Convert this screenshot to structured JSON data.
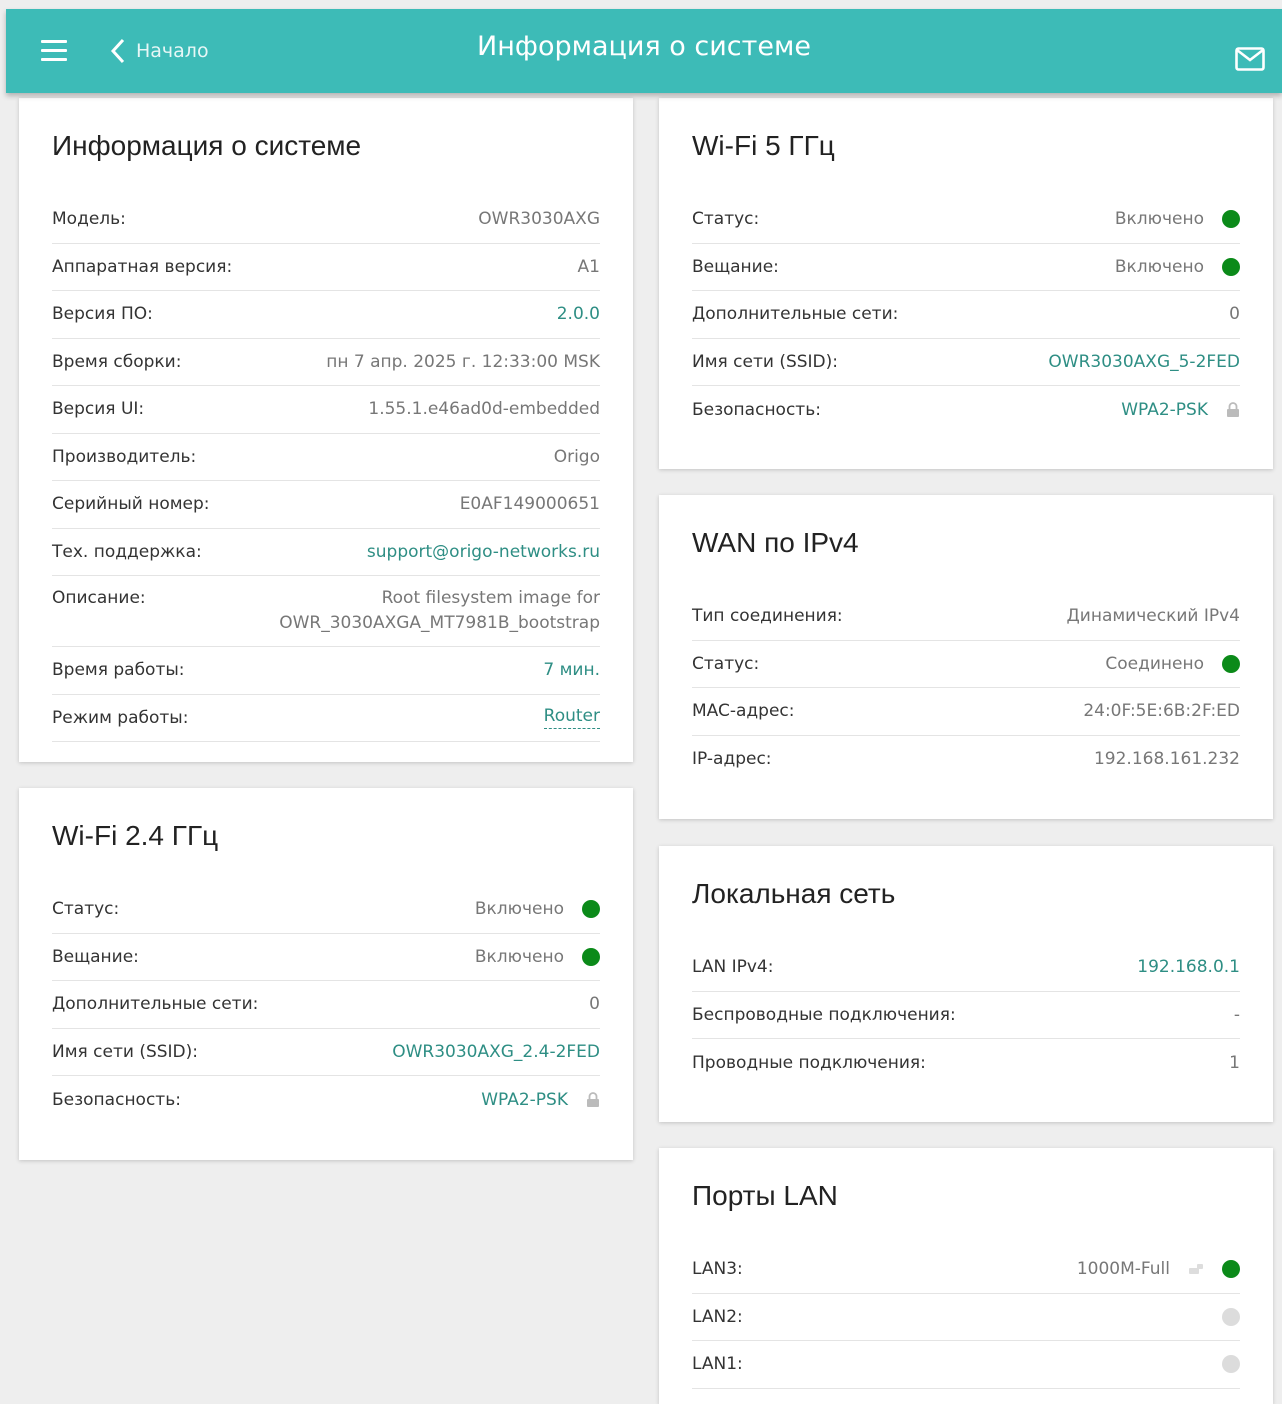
{
  "header": {
    "back_label": "Начало",
    "title": "Информация о системе"
  },
  "system": {
    "title": "Информация о системе",
    "rows": [
      {
        "label": "Модель:",
        "value": "OWR3030AXG"
      },
      {
        "label": "Аппаратная версия:",
        "value": "A1"
      },
      {
        "label": "Версия ПО:",
        "value": "2.0.0"
      },
      {
        "label": "Время сборки:",
        "value": "пн 7 апр. 2025 г. 12:33:00 MSK"
      },
      {
        "label": "Версия UI:",
        "value": "1.55.1.e46ad0d-embedded"
      },
      {
        "label": "Производитель:",
        "value": "Origo"
      },
      {
        "label": "Серийный номер:",
        "value": "E0AF149000651"
      },
      {
        "label": "Тех. поддержка:",
        "value": "support@origo-networks.ru"
      },
      {
        "label": "Описание:",
        "value_line1": "Root filesystem image for",
        "value_line2": "OWR_3030AXGA_MT7981B_bootstrap"
      },
      {
        "label": "Время работы:",
        "value": "7 мин."
      },
      {
        "label": "Режим работы:",
        "value": "Router"
      }
    ]
  },
  "wifi24": {
    "title": "Wi-Fi 2.4 ГГц",
    "rows": [
      {
        "label": "Статус:",
        "value": "Включено",
        "status": "green"
      },
      {
        "label": "Вещание:",
        "value": "Включено",
        "status": "green"
      },
      {
        "label": "Дополнительные сети:",
        "value": "0"
      },
      {
        "label": "Имя сети (SSID):",
        "value": "OWR3030AXG_2.4-2FED"
      },
      {
        "label": "Безопасность:",
        "value": "WPA2-PSK",
        "icon": "lock-icon"
      }
    ]
  },
  "wifi5": {
    "title": "Wi-Fi 5 ГГц",
    "rows": [
      {
        "label": "Статус:",
        "value": "Включено",
        "status": "green"
      },
      {
        "label": "Вещание:",
        "value": "Включено",
        "status": "green"
      },
      {
        "label": "Дополнительные сети:",
        "value": "0"
      },
      {
        "label": "Имя сети (SSID):",
        "value": "OWR3030AXG_5-2FED"
      },
      {
        "label": "Безопасность:",
        "value": "WPA2-PSK",
        "icon": "lock-icon"
      }
    ]
  },
  "wan": {
    "title": "WAN по IPv4",
    "rows": [
      {
        "label": "Тип соединения:",
        "value": "Динамический IPv4"
      },
      {
        "label": "Статус:",
        "value": "Соединено",
        "status": "green"
      },
      {
        "label": "MAC-адрес:",
        "value": "24:0F:5E:6B:2F:ED"
      },
      {
        "label": "IP-адрес:",
        "value": "192.168.161.232"
      }
    ]
  },
  "lan": {
    "title": "Локальная сеть",
    "rows": [
      {
        "label": "LAN IPv4:",
        "value": "192.168.0.1"
      },
      {
        "label": "Беспроводные подключения:",
        "value": "-"
      },
      {
        "label": "Проводные подключения:",
        "value": "1"
      }
    ]
  },
  "ports": {
    "title": "Порты LAN",
    "rows": [
      {
        "label": "LAN3:",
        "value": "1000M-Full",
        "status": "green",
        "icon": "cable-icon"
      },
      {
        "label": "LAN2:",
        "status": "grey"
      },
      {
        "label": "LAN1:",
        "status": "grey"
      }
    ]
  },
  "colors": {
    "accent": "#3dbbb7",
    "link": "#2e8e84",
    "status_on": "#0b8a19",
    "status_off": "#dcdcdc"
  }
}
